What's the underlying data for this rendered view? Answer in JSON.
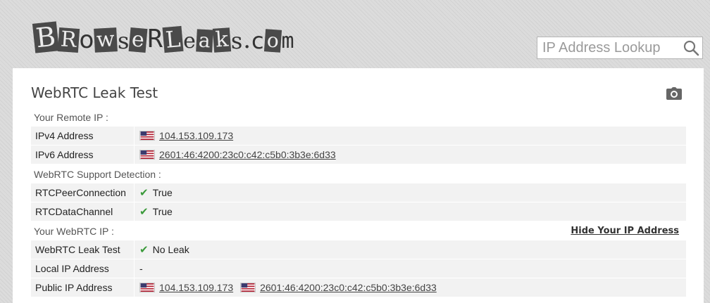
{
  "header": {
    "logo_text": "BrowserLeaks.com",
    "search": {
      "placeholder": "IP Address Lookup"
    }
  },
  "panel": {
    "title": "WebRTC Leak Test",
    "sections": {
      "remote_ip": {
        "heading": "Your Remote IP :",
        "rows": [
          {
            "label": "IPv4 Address",
            "value": "104.153.109.173"
          },
          {
            "label": "IPv6 Address",
            "value": "2601:46:4200:23c0:c42:c5b0:3b3e:6d33"
          }
        ]
      },
      "support": {
        "heading": "WebRTC Support Detection :",
        "rows": [
          {
            "label": "RTCPeerConnection",
            "value": "True"
          },
          {
            "label": "RTCDataChannel",
            "value": "True"
          }
        ]
      },
      "webrtc_ip": {
        "heading": "Your WebRTC IP :",
        "hide_link": "Hide Your IP Address",
        "rows": [
          {
            "label": "WebRTC Leak Test",
            "value": "No Leak"
          },
          {
            "label": "Local IP Address",
            "value": "-"
          },
          {
            "label": "Public IP Address",
            "value_v4": "104.153.109.173",
            "value_v6": "2601:46:4200:23c0:c42:c5b0:3b3e:6d33"
          }
        ]
      }
    }
  },
  "colors": {
    "check": "#3a9a3a",
    "row_bg": "#f2f2f2"
  }
}
